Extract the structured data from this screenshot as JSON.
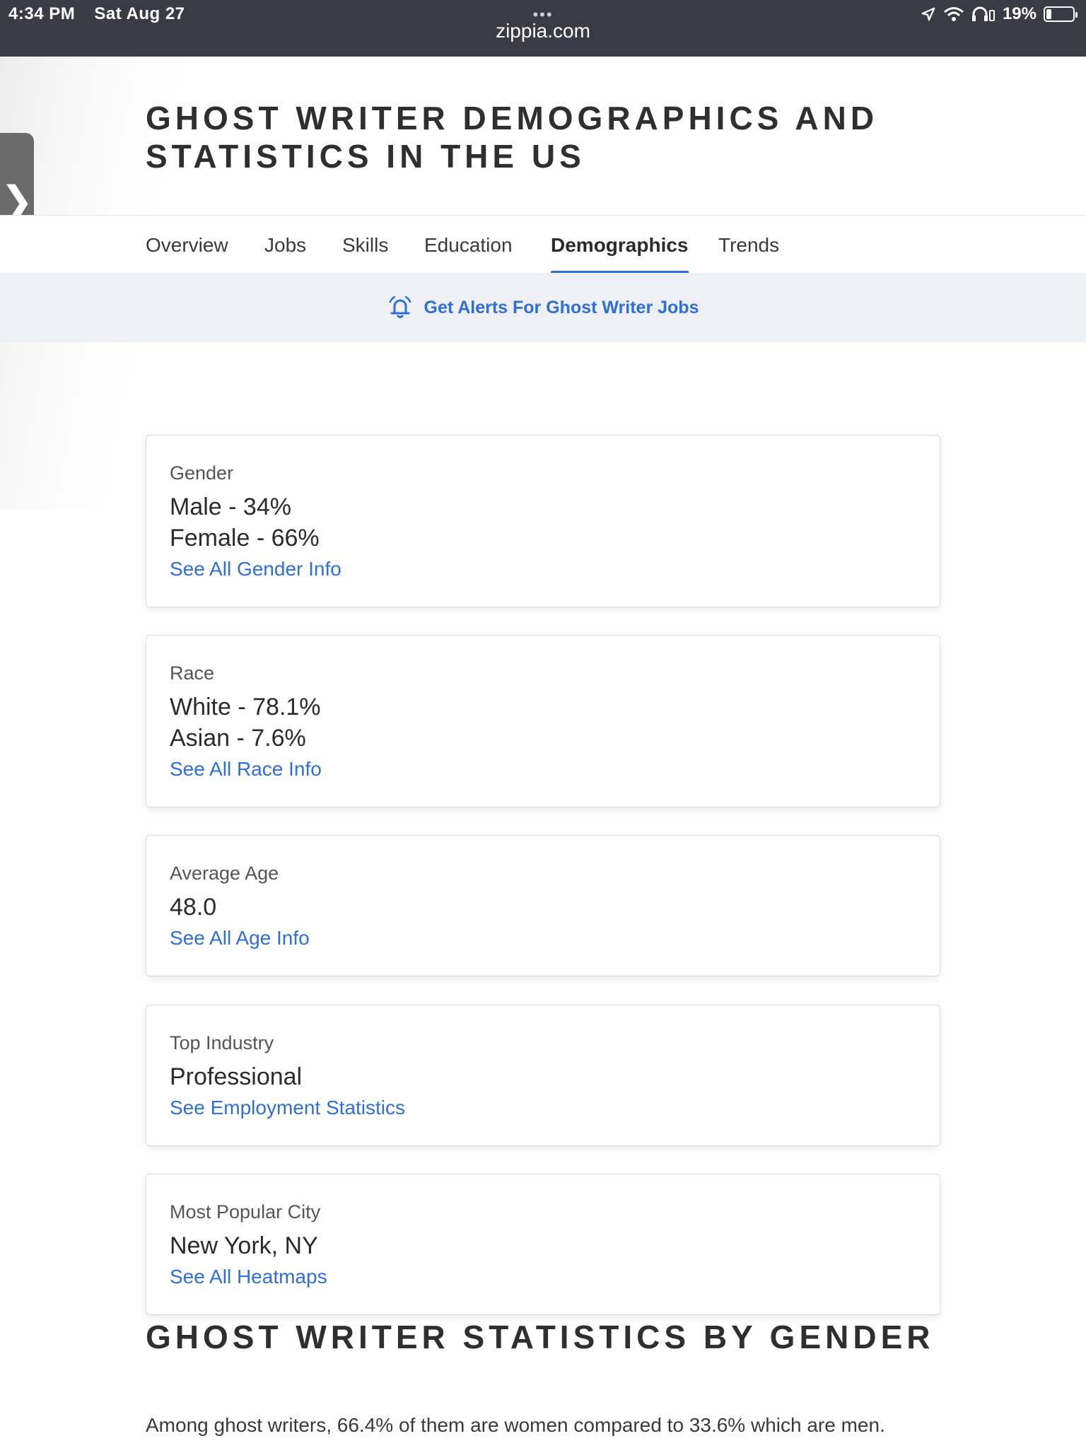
{
  "status_bar": {
    "time": "4:34 PM",
    "date": "Sat Aug 27",
    "url": "zippia.com",
    "battery": "19%",
    "battery_level": 0.19,
    "icons": [
      "location-arrow-icon",
      "wifi-icon",
      "headphones-icon",
      "battery-icon"
    ]
  },
  "side_tab": {
    "glyph": "❯"
  },
  "header": {
    "title_line1": "GHOST WRITER DEMOGRAPHICS AND",
    "title_line2": "STATISTICS IN THE US"
  },
  "nav": {
    "tabs": [
      {
        "label": "Overview",
        "active": false
      },
      {
        "label": "Jobs",
        "active": false
      },
      {
        "label": "Skills",
        "active": false
      },
      {
        "label": "Education",
        "active": false
      },
      {
        "label": "Demographics",
        "active": true
      },
      {
        "label": "Trends",
        "active": false
      }
    ],
    "accent_color": "#2e6fd9"
  },
  "alert": {
    "text": "Get Alerts For Ghost Writer Jobs",
    "icon": "bell-alert-icon"
  },
  "cards": [
    {
      "label": "Gender",
      "values": [
        "Male - 34%",
        "Female - 66%"
      ],
      "link": "See All Gender Info"
    },
    {
      "label": "Race",
      "values": [
        "White - 78.1%",
        "Asian - 7.6%"
      ],
      "link": "See All Race Info"
    },
    {
      "label": "Average Age",
      "values": [
        "48.0"
      ],
      "link": "See All Age Info"
    },
    {
      "label": "Top Industry",
      "values": [
        "Professional"
      ],
      "link": "See Employment Statistics"
    },
    {
      "label": "Most Popular City",
      "values": [
        "New York, NY"
      ],
      "link": "See All Heatmaps"
    }
  ],
  "section": {
    "title": "GHOST WRITER STATISTICS BY GENDER",
    "paragraph": "Among ghost writers, 66.4% of them are women compared to 33.6% which are men."
  }
}
